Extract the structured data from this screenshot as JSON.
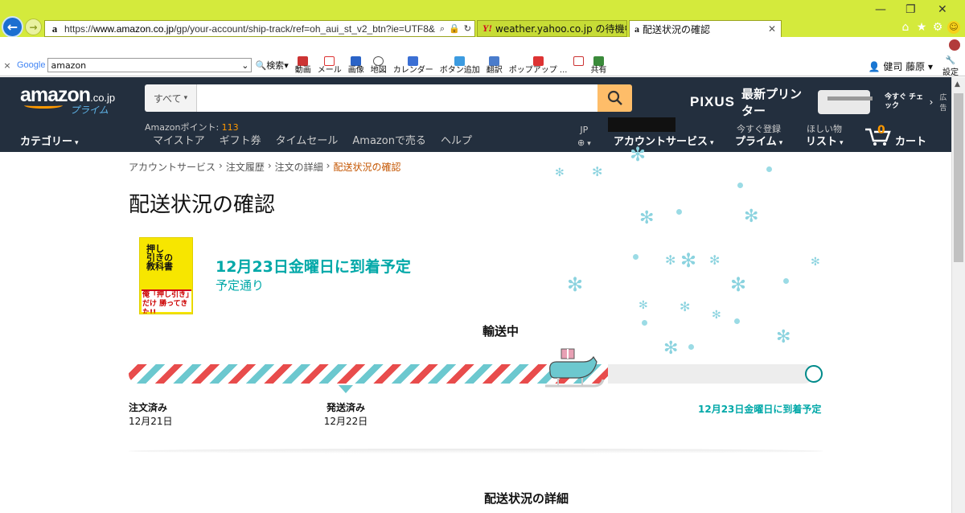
{
  "browser": {
    "url_scheme": "https://",
    "url_host": "www.amazon.co.jp",
    "url_path": "/gp/your-account/ship-track/ref=oh_aui_st_v2_btn?ie=UTF8&",
    "tabs": [
      {
        "title": "weather.yahoo.co.jp の待機中"
      },
      {
        "title": "配送状況の確認"
      }
    ]
  },
  "toolbar": {
    "search_value": "amazon",
    "search_button": "検索",
    "items": [
      "動画",
      "メール",
      "画像",
      "地図",
      "カレンダー",
      "ボタン追加",
      "翻訳",
      "ポップアップ ...",
      "共有"
    ],
    "user": "健司 藤原",
    "settings": "設定",
    "google_label": "Google"
  },
  "amazon": {
    "logo_word": "amazon",
    "logo_tld": ".co.jp",
    "logo_prime": "プライム",
    "search_category": "すべて",
    "promo_brand": "PIXUS",
    "promo_text": "最新プリンター",
    "promo_check": "今すぐ チェック",
    "promo_ad": "広告",
    "points_label": "Amazonポイント: ",
    "points_value": "113",
    "category": "カテゴリー",
    "nav": [
      "マイストア",
      "ギフト券",
      "タイムセール",
      "Amazonで売る",
      "ヘルプ"
    ],
    "lang": "JP",
    "account": "アカウントサービス",
    "prime_top": "今すぐ登録",
    "prime": "プライム",
    "wishlist_top": "ほしい物",
    "wishlist": "リスト",
    "cart_count": "0",
    "cart": "カート"
  },
  "breadcrumb": [
    "アカウントサービス",
    "注文履歴",
    "注文の詳細",
    "配送状況の確認"
  ],
  "page_title": "配送状況の確認",
  "shipment": {
    "eta": "12月23日金曜日に到着予定",
    "on_time": "予定通り",
    "status": "輸送中",
    "progress_fraction": 0.7,
    "milestones": [
      {
        "label": "注文済み",
        "date": "12月21日"
      },
      {
        "label": "発送済み",
        "date": "12月22日"
      }
    ],
    "eta_short": "12月23日金曜日に到着予定",
    "details_title": "配送状況の詳細"
  },
  "book": {
    "title_lines": [
      "押し",
      "引きの",
      "教科書"
    ],
    "tagline": "俺「押し引き」だけ 勝ってきた!!"
  },
  "colors": {
    "amazon_dark": "#232f3e",
    "amazon_orange": "#ff9900",
    "teal": "#00a8a8",
    "browser_chrome": "#d4ea3c"
  }
}
